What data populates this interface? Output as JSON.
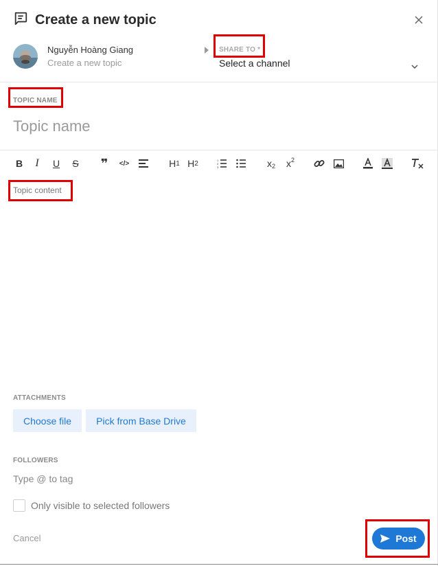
{
  "dialog": {
    "title": "Create a new topic"
  },
  "user": {
    "name": "Nguyễn Hoàng Giang",
    "subtitle": "Create a new topic"
  },
  "share": {
    "label": "SHARE TO *",
    "value": "Select a channel"
  },
  "topic": {
    "label": "TOPIC NAME",
    "placeholder": "Topic name"
  },
  "editor": {
    "toolbar": [
      {
        "name": "bold-icon",
        "glyph": "B"
      },
      {
        "name": "italic-icon",
        "glyph": "I"
      },
      {
        "name": "underline-icon",
        "glyph": "U"
      },
      {
        "name": "strikethrough-icon",
        "glyph": "S"
      },
      {
        "name": "quote-icon",
        "glyph": "❞"
      },
      {
        "name": "code-icon",
        "glyph": "</>"
      },
      {
        "name": "align-icon",
        "glyph": "≡"
      },
      {
        "name": "heading-1-icon",
        "glyph": "H₁"
      },
      {
        "name": "heading-2-icon",
        "glyph": "H₂"
      },
      {
        "name": "ordered-list-icon",
        "glyph": "1."
      },
      {
        "name": "bullet-list-icon",
        "glyph": "•"
      },
      {
        "name": "subscript-icon",
        "glyph": "x₂"
      },
      {
        "name": "superscript-icon",
        "glyph": "x²"
      },
      {
        "name": "link-icon",
        "glyph": "🔗"
      },
      {
        "name": "image-icon",
        "glyph": "▣"
      },
      {
        "name": "text-color-icon",
        "glyph": "A"
      },
      {
        "name": "highlight-icon",
        "glyph": "A"
      },
      {
        "name": "clear-format-icon",
        "glyph": "Tx"
      }
    ],
    "placeholder": "Topic content"
  },
  "attachments": {
    "label": "ATTACHMENTS",
    "choose_file": "Choose file",
    "pick_drive": "Pick from Base Drive"
  },
  "followers": {
    "label": "FOLLOWERS",
    "placeholder": "Type @ to tag",
    "only_visible": "Only visible to selected followers"
  },
  "actions": {
    "cancel": "Cancel",
    "post": "Post"
  },
  "colors": {
    "accent": "#1e78d6",
    "highlight": "#e00000",
    "button_bg": "#e8f1fb"
  }
}
